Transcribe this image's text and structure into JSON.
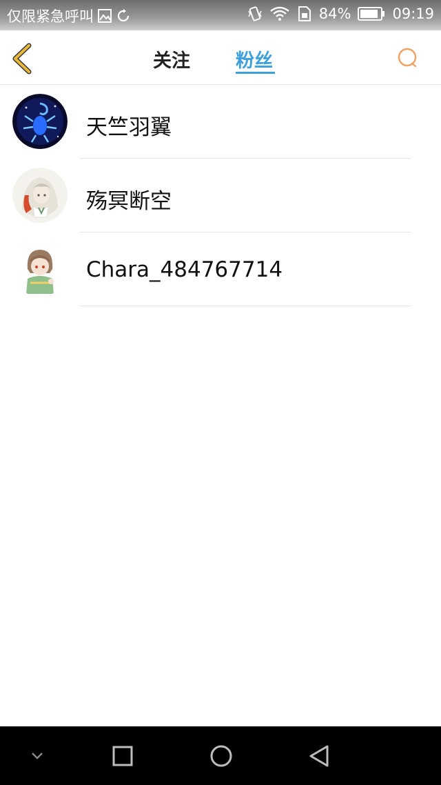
{
  "status_bar": {
    "carrier_text": "仅限紧急呼叫",
    "battery": "84%",
    "time": "09:19",
    "icons": [
      "gallery-icon",
      "sync-icon",
      "vibrate-icon",
      "wifi-icon",
      "sim-icon",
      "battery-icon"
    ]
  },
  "header": {
    "back_icon": "chevron-left-icon",
    "tabs": [
      {
        "label": "关注",
        "active": false
      },
      {
        "label": "粉丝",
        "active": true
      }
    ],
    "search_icon": "search-icon"
  },
  "fans": [
    {
      "name": "天竺羽翼",
      "avatar": "scorpion-avatar"
    },
    {
      "name": "殇冥断空",
      "avatar": "anime-girl-avatar"
    },
    {
      "name": "Chara_484767714",
      "avatar": "chara-avatar"
    }
  ],
  "colors": {
    "accent": "#3ba0dc",
    "back_icon": "#e9b93c",
    "search_icon": "#f0a060"
  },
  "nav_bar": {
    "buttons": [
      "collapse-icon",
      "recents-icon",
      "home-icon",
      "back-triangle-icon"
    ]
  }
}
